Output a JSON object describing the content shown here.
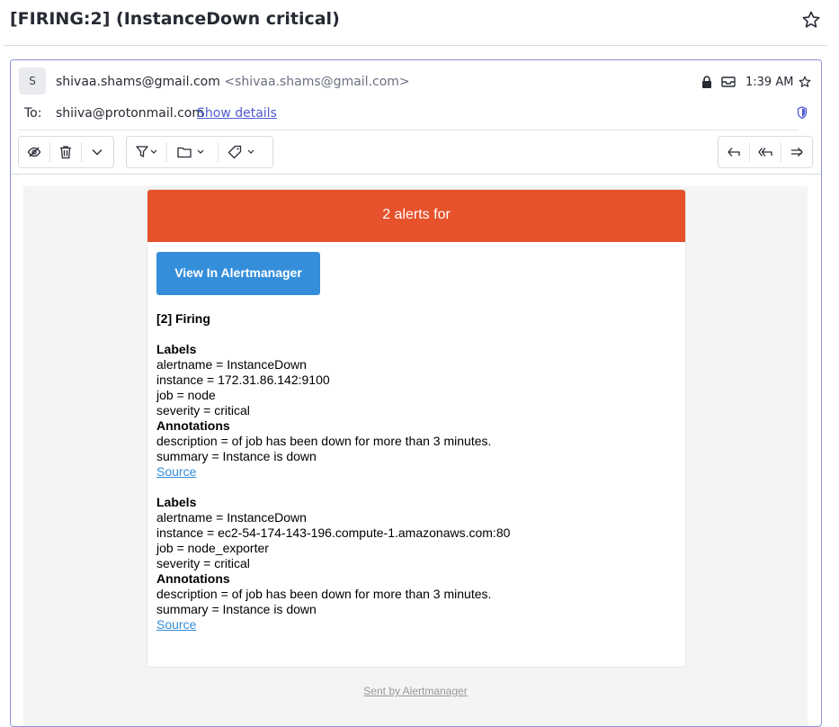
{
  "subject": "[FIRING:2] (InstanceDown critical)",
  "header": {
    "avatar_initial": "S",
    "sender_name": "shivaa.shams@gmail.com",
    "sender_address": "<shivaa.shams@gmail.com>",
    "time": "1:39 AM",
    "to_label": "To:",
    "to_address": "shiiva@protonmail.com",
    "show_details": "Show details"
  },
  "toolbar": {
    "left_group": [
      "mark-unread-icon",
      "trash-icon",
      "chevron-down-icon"
    ],
    "middle_group": [
      "filter-icon",
      "folder-icon",
      "tag-icon"
    ],
    "right_group": [
      "reply-icon",
      "reply-all-icon",
      "forward-icon"
    ]
  },
  "email": {
    "header_text": "2 alerts for",
    "button_label": "View In Alertmanager",
    "firing_title": "[2] Firing",
    "labels_heading": "Labels",
    "annotations_heading": "Annotations",
    "source_label": "Source",
    "alerts": [
      {
        "labels": [
          "alertname = InstanceDown",
          "instance = 172.31.86.142:9100",
          "job = node",
          "severity = critical"
        ],
        "annotations": [
          "description = of job has been down for more than 3 minutes.",
          "summary = Instance is down"
        ]
      },
      {
        "labels": [
          "alertname = InstanceDown",
          "instance = ec2-54-174-143-196.compute-1.amazonaws.com:80",
          "job = node_exporter",
          "severity = critical"
        ],
        "annotations": [
          "description = of job has been down for more than 3 minutes.",
          "summary = Instance is down"
        ]
      }
    ],
    "footer": "Sent by Alertmanager"
  },
  "colors": {
    "alert_header": "#e6522c",
    "button": "#348eda",
    "link": "#4f5bd5",
    "message_border": "#8c92d9"
  }
}
